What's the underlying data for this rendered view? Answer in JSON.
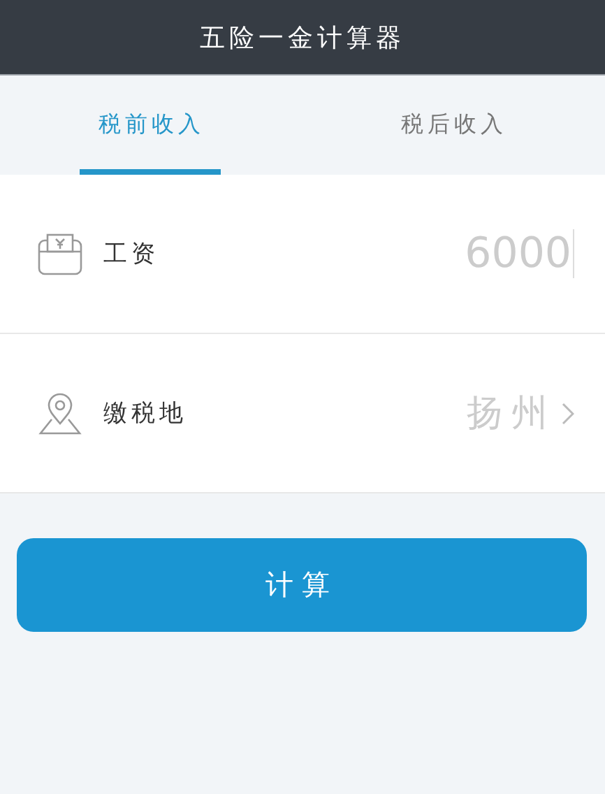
{
  "window": {
    "title": "五险一金计算器"
  },
  "tabs": [
    {
      "label": "税前收入",
      "selected": true
    },
    {
      "label": "税后收入",
      "selected": false
    }
  ],
  "rows": [
    {
      "kind": "input",
      "label": "工资",
      "placeholder": "6000"
    },
    {
      "kind": "select",
      "label": "缴税地",
      "value": "扬州"
    }
  ],
  "button": "计算"
}
